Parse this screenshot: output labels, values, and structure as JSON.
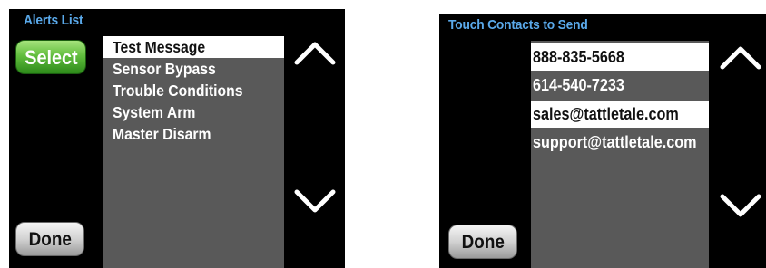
{
  "alerts_screen": {
    "title": "Alerts List",
    "select_label": "Select",
    "done_label": "Done",
    "items": [
      {
        "label": "Test Message",
        "selected": true
      },
      {
        "label": "Sensor Bypass",
        "selected": false
      },
      {
        "label": "Trouble Conditions",
        "selected": false
      },
      {
        "label": "System Arm",
        "selected": false
      },
      {
        "label": "Master Disarm",
        "selected": false
      }
    ],
    "icons": {
      "up": "chevron-up-icon",
      "down": "chevron-down-icon"
    }
  },
  "contacts_screen": {
    "title": "Touch Contacts to Send",
    "done_label": "Done",
    "items": [
      {
        "label": "888-835-5668",
        "selected": true
      },
      {
        "label": "614-540-7233",
        "selected": false
      },
      {
        "label": "sales@tattletale.com",
        "selected": true
      },
      {
        "label": "support@tattletale.com",
        "selected": false
      }
    ],
    "icons": {
      "up": "chevron-up-icon",
      "down": "chevron-down-icon"
    }
  },
  "colors": {
    "screen_bg": "#000000",
    "title": "#5aa9ea",
    "list_bg": "#595959",
    "selected_bg": "#ffffff",
    "select_button": "#62be3e"
  }
}
